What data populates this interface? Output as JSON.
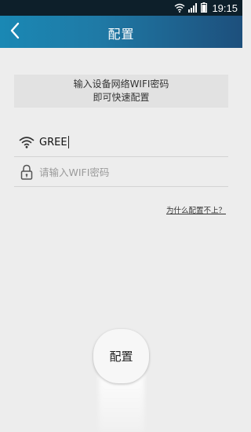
{
  "status_bar": {
    "time": "19:15",
    "icons": [
      "wifi-icon",
      "signal-icon",
      "battery-icon"
    ]
  },
  "header": {
    "title": "配置",
    "back_icon": "chevron-left-icon"
  },
  "hint": {
    "line1": "输入设备网络WIFI密码",
    "line2": "即可快速配置"
  },
  "ssid_field": {
    "icon": "wifi-icon",
    "value": "GREE"
  },
  "password_field": {
    "icon": "lock-icon",
    "placeholder": "请输入WIFI密码",
    "value": ""
  },
  "why_link": {
    "label": "为什么配置不上？"
  },
  "config_button": {
    "label": "配置"
  },
  "colors": {
    "header_start": "#1a88b4",
    "header_end": "#1d4f7c",
    "background": "#ededed",
    "status_bar": "#0d1f2a"
  }
}
